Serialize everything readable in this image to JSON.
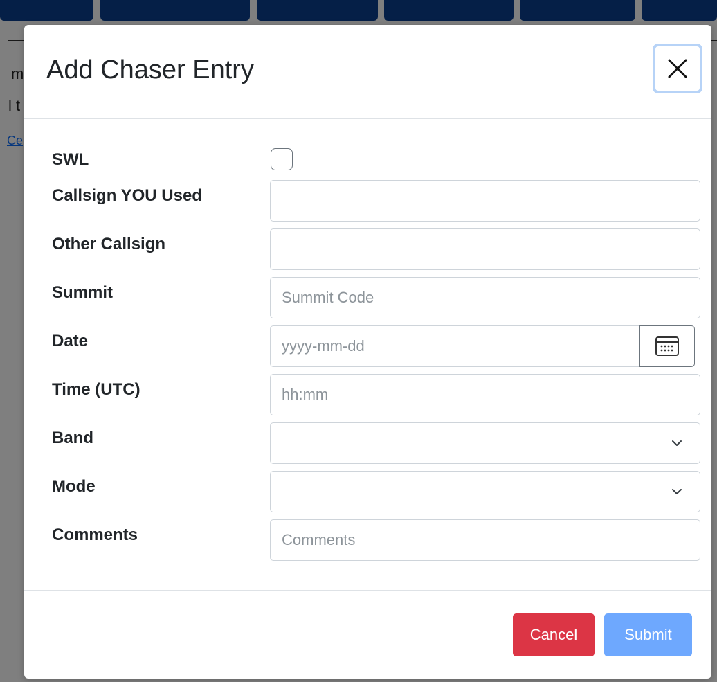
{
  "modal": {
    "title": "Add Chaser Entry",
    "fields": {
      "swl": {
        "label": "SWL",
        "checked": false
      },
      "callsign_used": {
        "label": "Callsign YOU Used",
        "value": "",
        "placeholder": ""
      },
      "other_callsign": {
        "label": "Other Callsign",
        "value": "",
        "placeholder": ""
      },
      "summit": {
        "label": "Summit",
        "value": "",
        "placeholder": "Summit Code"
      },
      "date": {
        "label": "Date",
        "value": "",
        "placeholder": "yyyy-mm-dd"
      },
      "time": {
        "label": "Time (UTC)",
        "value": "",
        "placeholder": "hh:mm"
      },
      "band": {
        "label": "Band",
        "selected": ""
      },
      "mode": {
        "label": "Mode",
        "selected": ""
      },
      "comments": {
        "label": "Comments",
        "value": "",
        "placeholder": "Comments"
      }
    },
    "buttons": {
      "cancel": "Cancel",
      "submit": "Submit"
    }
  },
  "icons": {
    "close": "close-icon",
    "calendar": "calendar-icon",
    "chevron": "chevron-down-icon"
  },
  "colors": {
    "cancel": "#dc3545",
    "submit": "#6ea8fe",
    "nav": "#0b3e8f",
    "focus_ring": "#b7d3f7"
  }
}
